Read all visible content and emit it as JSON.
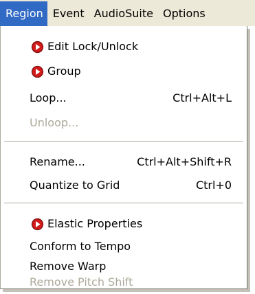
{
  "menubar": {
    "items": [
      "Region",
      "Event",
      "AudioSuite",
      "Options"
    ],
    "active_index": 0
  },
  "menu": {
    "sections": [
      {
        "items": [
          {
            "label": "Edit Lock/Unlock",
            "icon": "record-arrow-icon",
            "shortcut": "",
            "disabled": false
          },
          {
            "label": "Group",
            "icon": "record-arrow-icon",
            "shortcut": "",
            "disabled": false
          },
          {
            "label": "Loop...",
            "icon": "",
            "shortcut": "Ctrl+Alt+L",
            "disabled": false
          },
          {
            "label": "Unloop...",
            "icon": "",
            "shortcut": "",
            "disabled": true
          }
        ]
      },
      {
        "items": [
          {
            "label": "Rename...",
            "icon": "",
            "shortcut": "Ctrl+Alt+Shift+R",
            "disabled": false
          },
          {
            "label": "Quantize to Grid",
            "icon": "",
            "shortcut": "Ctrl+0",
            "disabled": false
          }
        ]
      },
      {
        "items": [
          {
            "label": "Elastic Properties",
            "icon": "record-arrow-icon",
            "shortcut": "",
            "disabled": false
          },
          {
            "label": "Conform to Tempo",
            "icon": "",
            "shortcut": "",
            "disabled": false
          },
          {
            "label": "Remove Warp",
            "icon": "",
            "shortcut": "",
            "disabled": false
          },
          {
            "label": "Remove Pitch Shift",
            "icon": "",
            "shortcut": "",
            "disabled": true
          }
        ]
      }
    ]
  },
  "colors": {
    "menubar_bg": "#ece9d8",
    "highlight_bg": "#316ac5",
    "highlight_text": "#ffffff",
    "disabled_text": "#aca899",
    "icon_red": "#d11a1a"
  }
}
